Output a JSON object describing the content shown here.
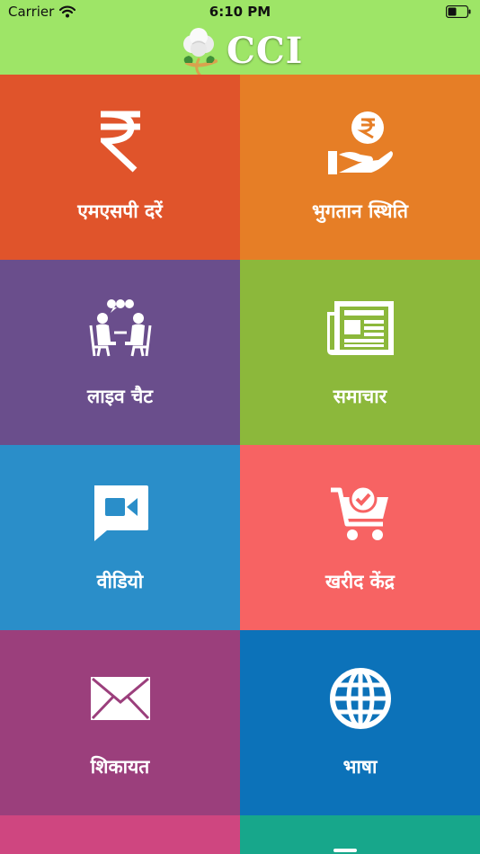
{
  "status_bar": {
    "carrier": "Carrier",
    "time": "6:10 PM",
    "wifi_icon": "wifi-icon",
    "battery_icon": "battery-icon"
  },
  "header": {
    "title": "CCI",
    "logo_icon": "cotton-plant-icon",
    "background": "#9ee567"
  },
  "tiles": [
    {
      "label": "एमएसपी दरें",
      "icon": "rupee-icon",
      "color": "#e0542b"
    },
    {
      "label": "भुगतान स्थिति",
      "icon": "payment-hand-icon",
      "color": "#e67e26"
    },
    {
      "label": "लाइव चैट",
      "icon": "chat-people-icon",
      "color": "#6a4e8c"
    },
    {
      "label": "समाचार",
      "icon": "newspaper-icon",
      "color": "#8cb83b"
    },
    {
      "label": "वीडियो",
      "icon": "video-camera-icon",
      "color": "#2a8ec9"
    },
    {
      "label": "खरीद केंद्र",
      "icon": "cart-check-icon",
      "color": "#f76363"
    },
    {
      "label": "शिकायत",
      "icon": "envelope-icon",
      "color": "#9b3f7c"
    },
    {
      "label": "भाषा",
      "icon": "globe-icon",
      "color": "#0c72b9"
    },
    {
      "label": "",
      "icon": "",
      "color": "#cf4680"
    },
    {
      "label": "",
      "icon": "",
      "color": "#17a78b"
    }
  ]
}
